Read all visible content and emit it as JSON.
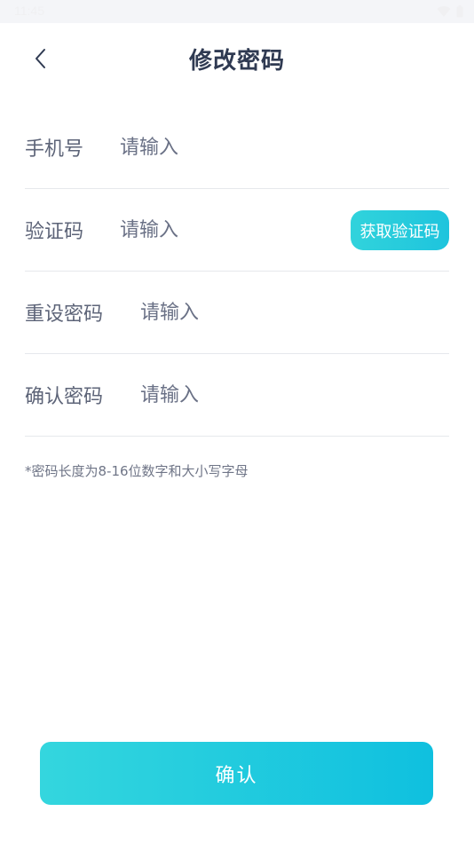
{
  "status_bar": {
    "time": "11:45",
    "icons": [
      "wifi-icon",
      "battery-icon"
    ]
  },
  "header": {
    "title": "修改密码",
    "back_icon": "chevron-left-icon"
  },
  "form": {
    "phone": {
      "label": "手机号",
      "placeholder": "请输入"
    },
    "code": {
      "label": "验证码",
      "placeholder": "请输入",
      "button": "获取验证码"
    },
    "new_password": {
      "label": "重设密码",
      "placeholder": "请输入"
    },
    "confirm_password": {
      "label": "确认密码",
      "placeholder": "请输入"
    }
  },
  "hint": "*密码长度为8-16位数字和大小写字母",
  "confirm_button": "确认",
  "colors": {
    "accent_start": "#34d6de",
    "accent_end": "#0fc0df",
    "title": "#2f3a52",
    "label": "#5d6478",
    "divider": "#e6e8ec"
  }
}
